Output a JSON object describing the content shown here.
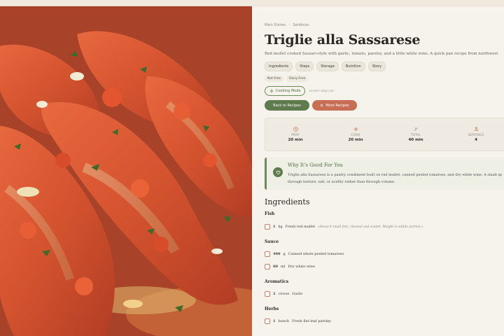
{
  "breadcrumb": [
    "Main Dishes",
    "Sardinian"
  ],
  "title": "Triglie alla Sassarese",
  "subtitle": "Red mullet cooked Sassari-style with garlic, tomato, parsley, and a little white wine. A quick pan recipe from northwest",
  "nav_pills": [
    "Ingredients",
    "Steps",
    "Storage",
    "Nutrition",
    "Story"
  ],
  "tags": [
    "Nut-Free",
    "Dairy-Free"
  ],
  "cooking_mode": {
    "label": "Cooking Mode",
    "hint": "screen stays on"
  },
  "buttons": {
    "back": "Back to Recipes",
    "more": "More Recipes"
  },
  "stats": [
    {
      "icon": "clock-icon",
      "label": "PREP",
      "value": "20 min"
    },
    {
      "icon": "flame-icon",
      "label": "COOK",
      "value": "20 min"
    },
    {
      "icon": "timer-icon",
      "label": "TOTAL",
      "value": "40 min"
    },
    {
      "icon": "people-icon",
      "label": "SERVINGS",
      "value": "4"
    }
  ],
  "why": {
    "heading": "Why It's Good For You",
    "line1": "Triglie alla Sassarese is a pantry condiment built on red mullet, canned peeled tomatoes, and dry white wine. A small sp",
    "line2": "through texture, salt, or acidity rather than through volume."
  },
  "ingredients_title": "Ingredients",
  "groups": [
    {
      "title": "Fish",
      "items": [
        {
          "qty": "1",
          "unit": "kg",
          "name": "Fresh red mullet",
          "note": "(About 8 small fish, cleaned and scaled. Weight is edible portion.)"
        }
      ]
    },
    {
      "title": "Sauce",
      "items": [
        {
          "qty": "400",
          "unit": "g",
          "name": "Canned whole peeled tomatoes",
          "note": ""
        },
        {
          "qty": "60",
          "unit": "ml",
          "name": "Dry white wine",
          "note": ""
        }
      ]
    },
    {
      "title": "Aromatics",
      "items": [
        {
          "qty": "2",
          "unit": "cloves",
          "name": "Garlic",
          "note": ""
        }
      ]
    },
    {
      "title": "Herbs",
      "items": [
        {
          "qty": "1",
          "unit": "bunch",
          "name": "Fresh flat-leaf parsley",
          "note": ""
        }
      ]
    }
  ],
  "colors": {
    "accent_green": "#5f7a4d",
    "accent_terracotta": "#c86e55",
    "background": "#f6f3ec"
  }
}
